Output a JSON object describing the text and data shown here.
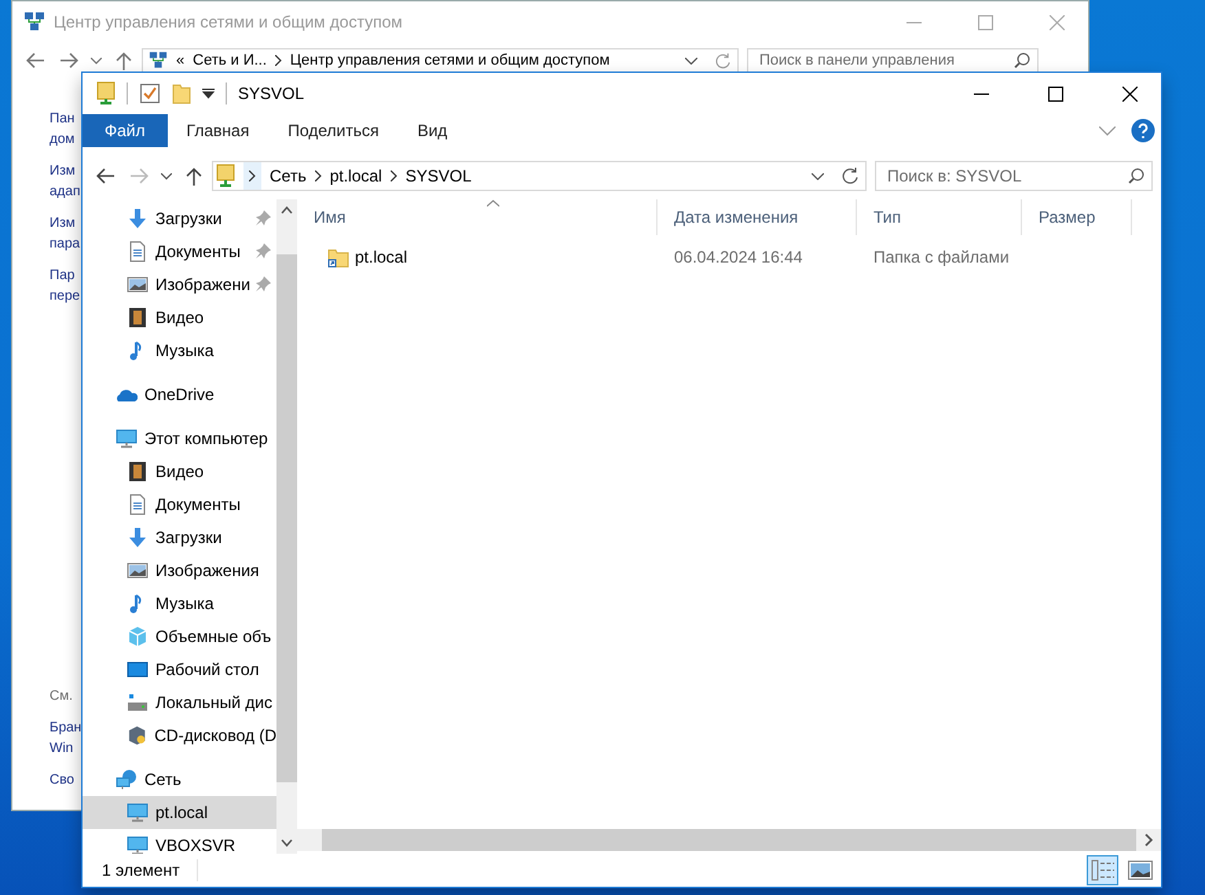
{
  "back_window": {
    "title": "Центр управления сетями и общим доступом",
    "crumbs": [
      "Сеть и И...",
      "Центр управления сетями и общим доступом"
    ],
    "crumb_prefix": "«",
    "search": {
      "placeholder": "Поиск в панели управления"
    },
    "tasks": [
      [
        "Пан",
        "дом"
      ],
      [
        "Изм",
        "адап"
      ],
      [
        "Изм",
        "пара"
      ],
      [
        "Пар",
        "пере"
      ]
    ],
    "see_also": {
      "heading": "См.",
      "links": [
        [
          "Бран",
          "Win"
        ],
        [
          "Сво"
        ]
      ]
    }
  },
  "window": {
    "title": "SYSVOL",
    "ribbon_tabs": [
      {
        "label": "Файл",
        "selected": true
      },
      {
        "label": "Главная",
        "selected": false
      },
      {
        "label": "Поделиться",
        "selected": false
      },
      {
        "label": "Вид",
        "selected": false
      }
    ],
    "crumbs": [
      "Сеть",
      "pt.local",
      "SYSVOL"
    ],
    "search": {
      "placeholder": "Поиск в: SYSVOL"
    },
    "nav": [
      {
        "kind": "group",
        "children": [
          {
            "label": "Загрузки",
            "kind": "download",
            "pinned": true,
            "selected": false
          },
          {
            "label": "Документы",
            "kind": "document",
            "pinned": true,
            "selected": false
          },
          {
            "label": "Изображени",
            "kind": "pictures",
            "pinned": true,
            "selected": false
          },
          {
            "label": "Видео",
            "kind": "video",
            "selected": false
          },
          {
            "label": "Музыка",
            "kind": "music",
            "selected": false
          }
        ]
      },
      {
        "label": "OneDrive",
        "kind": "cloud",
        "selected": false
      },
      {
        "label": "Этот компьютер",
        "kind": "computer",
        "selected": false,
        "children": [
          {
            "label": "Видео",
            "kind": "video",
            "selected": false
          },
          {
            "label": "Документы",
            "kind": "document",
            "selected": false
          },
          {
            "label": "Загрузки",
            "kind": "download",
            "selected": false
          },
          {
            "label": "Изображения",
            "kind": "pictures",
            "selected": false
          },
          {
            "label": "Музыка",
            "kind": "music",
            "selected": false
          },
          {
            "label": "Объемные объ",
            "kind": "cube",
            "selected": false
          },
          {
            "label": "Рабочий стол",
            "kind": "desktop",
            "selected": false
          },
          {
            "label": "Локальный дис",
            "kind": "drive",
            "selected": false
          },
          {
            "label": "CD-дисковод (D",
            "kind": "cd",
            "selected": false
          }
        ]
      },
      {
        "label": "Сеть",
        "kind": "network",
        "selected": false,
        "children": [
          {
            "label": "pt.local",
            "kind": "monitor",
            "selected": true
          },
          {
            "label": "VBOXSVR",
            "kind": "monitor",
            "selected": false
          }
        ]
      }
    ],
    "columns": [
      {
        "label": "Имя",
        "sorted": true
      },
      {
        "label": "Дата изменения"
      },
      {
        "label": "Тип"
      },
      {
        "label": "Размер"
      }
    ],
    "rows": [
      {
        "name": "pt.local",
        "date": "06.04.2024 16:44",
        "type": "Папка с файлами"
      }
    ],
    "status": "1 элемент",
    "views": [
      {
        "kind": "details",
        "selected": true
      },
      {
        "kind": "large",
        "selected": false
      }
    ]
  }
}
